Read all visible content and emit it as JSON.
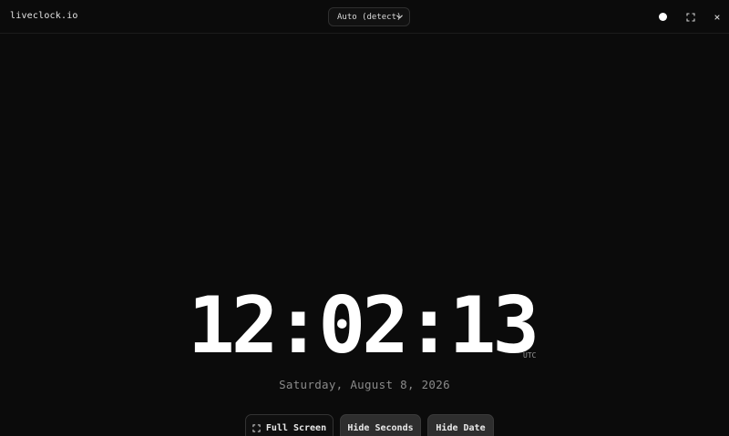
{
  "header": {
    "brand": "liveclock.io",
    "timezone_select": {
      "selected": "Auto (detect)"
    },
    "icons": [
      "theme-toggle-icon",
      "fullscreen-icon",
      "close-icon"
    ]
  },
  "clock": {
    "time": "12:02:13",
    "timezone_label": "UTC",
    "date": "Saturday, August 8, 2026"
  },
  "actions": {
    "fullscreen_label": "Full Screen",
    "hide_seconds_label": "Hide Seconds",
    "hide_date_label": "Hide Date"
  },
  "colors": {
    "background": "#0b0b0b",
    "text": "#ffffff",
    "muted": "#8a8a8a",
    "button_filled": "#2e2e2e"
  }
}
